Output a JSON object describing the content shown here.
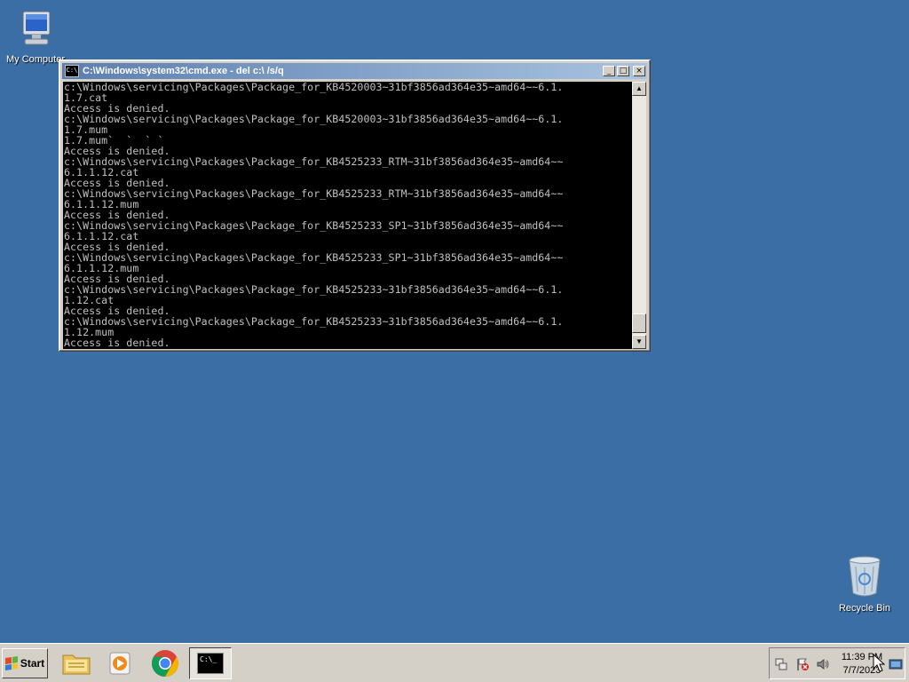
{
  "desktop": {
    "icons": [
      {
        "label": "My Computer"
      },
      {
        "label": "Recycle Bin"
      }
    ]
  },
  "cmd_window": {
    "title": "C:\\Windows\\system32\\cmd.exe - del  c:\\ /s/q",
    "output": "c:\\Windows\\servicing\\Packages\\Package_for_KB4520003~31bf3856ad364e35~amd64~~6.1.\n1.7.cat\nAccess is denied.\nc:\\Windows\\servicing\\Packages\\Package_for_KB4520003~31bf3856ad364e35~amd64~~6.1.\n1.7.mum\n1.7.mum`  `  ` `\nAccess is denied.\nc:\\Windows\\servicing\\Packages\\Package_for_KB4525233_RTM~31bf3856ad364e35~amd64~~\n6.1.1.12.cat\nAccess is denied.\nc:\\Windows\\servicing\\Packages\\Package_for_KB4525233_RTM~31bf3856ad364e35~amd64~~\n6.1.1.12.mum\nAccess is denied.\nc:\\Windows\\servicing\\Packages\\Package_for_KB4525233_SP1~31bf3856ad364e35~amd64~~\n6.1.1.12.cat\nAccess is denied.\nc:\\Windows\\servicing\\Packages\\Package_for_KB4525233_SP1~31bf3856ad364e35~amd64~~\n6.1.1.12.mum\nAccess is denied.\nc:\\Windows\\servicing\\Packages\\Package_for_KB4525233~31bf3856ad364e35~amd64~~6.1.\n1.12.cat\nAccess is denied.\nc:\\Windows\\servicing\\Packages\\Package_for_KB4525233~31bf3856ad364e35~amd64~~6.1.\n1.12.mum\nAccess is denied.",
    "icon_text": "C:\\",
    "buttons": {
      "minimize": "_",
      "maximize": "□",
      "close": "×"
    }
  },
  "taskbar": {
    "start_label": "Start",
    "apps": [
      {
        "icon": "file-explorer-icon"
      },
      {
        "icon": "media-player-icon"
      },
      {
        "icon": "chrome-icon"
      },
      {
        "icon": "cmd-icon",
        "active": true,
        "icon_text": "C:\\_"
      }
    ],
    "clock": {
      "time": "11:39 PM",
      "date": "7/7/2023"
    },
    "colors": {
      "desktop": "#3a6ea5",
      "taskbar": "#d4d0c8",
      "title_start": "#5c7fb0",
      "title_end": "#a9c3e0"
    }
  }
}
